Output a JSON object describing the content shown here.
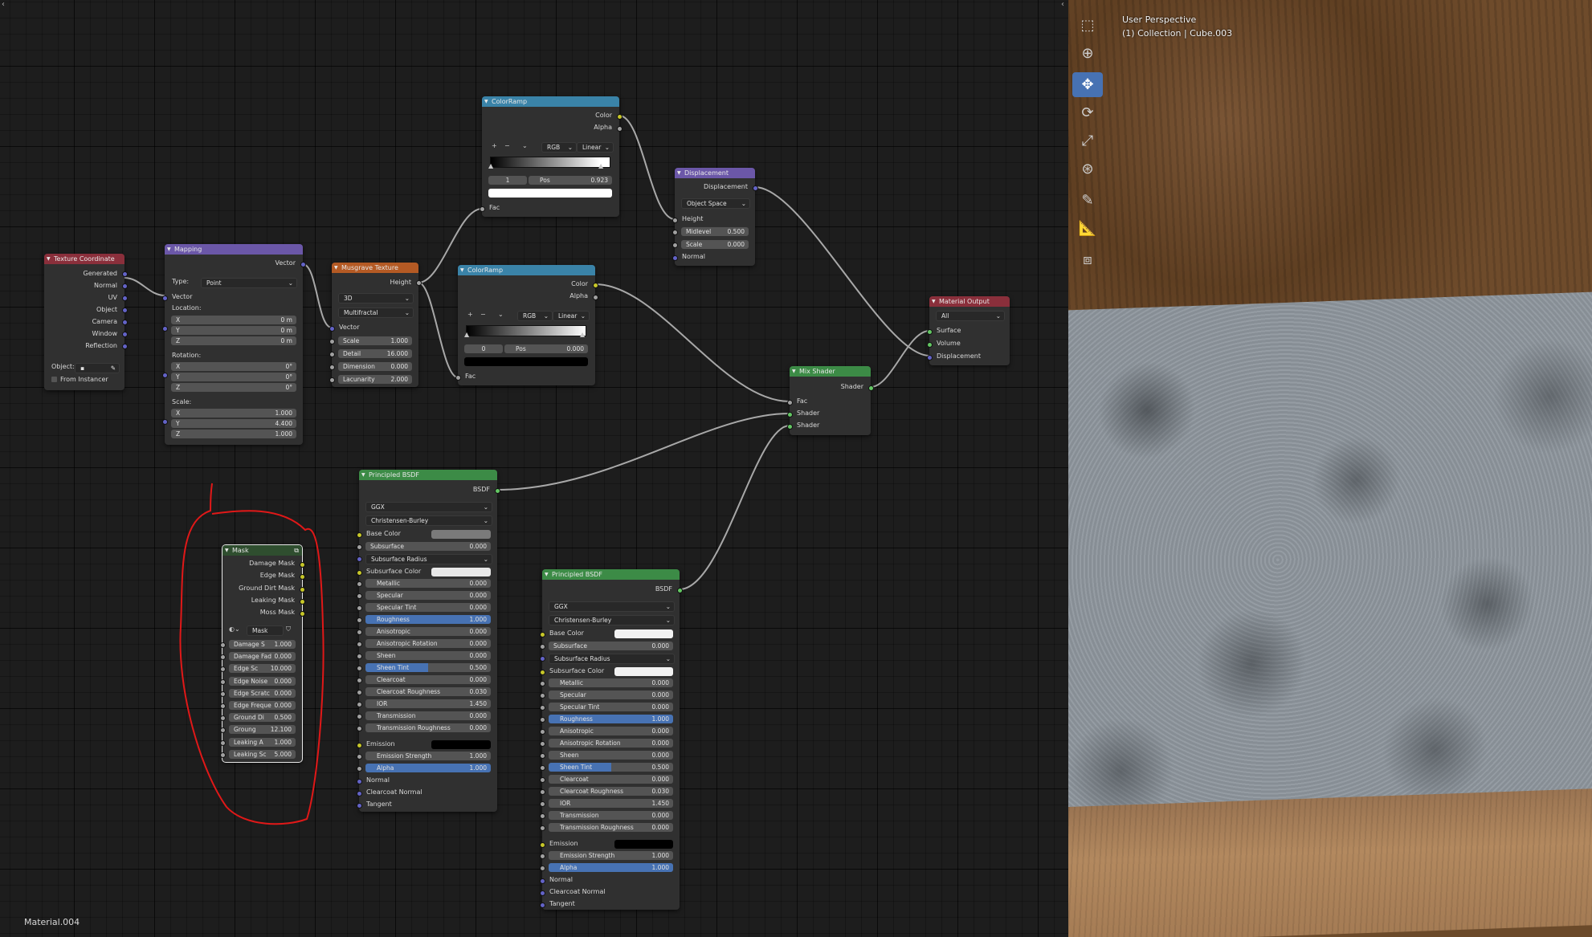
{
  "editor": {
    "material_name": "Material.004"
  },
  "viewport": {
    "title": "User Perspective",
    "subtitle": "(1) Collection | Cube.003",
    "tools": [
      "select-box-icon",
      "cursor-icon",
      "move-icon",
      "rotate-icon",
      "scale-icon",
      "transform-icon",
      "annotate-icon",
      "measure-icon",
      "add-cube-icon"
    ]
  },
  "nodes": {
    "texcoord": {
      "title": "Texture Coordinate",
      "outputs": [
        "Generated",
        "Normal",
        "UV",
        "Object",
        "Camera",
        "Window",
        "Reflection"
      ],
      "object_label": "Object:",
      "from_instancer": "From Instancer"
    },
    "mapping": {
      "title": "Mapping",
      "output": "Vector",
      "type_label": "Type:",
      "type_value": "Point",
      "vector_label": "Vector",
      "location_label": "Location:",
      "location": [
        {
          "l": "X",
          "v": "0 m"
        },
        {
          "l": "Y",
          "v": "0 m"
        },
        {
          "l": "Z",
          "v": "0 m"
        }
      ],
      "rotation_label": "Rotation:",
      "rotation": [
        {
          "l": "X",
          "v": "0°"
        },
        {
          "l": "Y",
          "v": "0°"
        },
        {
          "l": "Z",
          "v": "0°"
        }
      ],
      "scale_label": "Scale:",
      "scale": [
        {
          "l": "X",
          "v": "1.000"
        },
        {
          "l": "Y",
          "v": "4.400"
        },
        {
          "l": "Z",
          "v": "1.000"
        }
      ]
    },
    "musgrave": {
      "title": "Musgrave Texture",
      "output": "Height",
      "dim": "3D",
      "kind": "Multifractal",
      "vector": "Vector",
      "fields": [
        {
          "l": "Scale",
          "v": "1.000"
        },
        {
          "l": "Detail",
          "v": "16.000"
        },
        {
          "l": "Dimension",
          "v": "0.000"
        },
        {
          "l": "Lacunarity",
          "v": "2.000"
        }
      ]
    },
    "ramp1": {
      "title": "ColorRamp",
      "out_color": "Color",
      "out_alpha": "Alpha",
      "mode": "RGB",
      "interp": "Linear",
      "index": "1",
      "pos_label": "Pos",
      "pos_value": "0.923",
      "fac": "Fac",
      "swatch": "#ffffff"
    },
    "ramp2": {
      "title": "ColorRamp",
      "out_color": "Color",
      "out_alpha": "Alpha",
      "mode": "RGB",
      "interp": "Linear",
      "index": "0",
      "pos_label": "Pos",
      "pos_value": "0.000",
      "fac": "Fac",
      "swatch": "#000000"
    },
    "displacement": {
      "title": "Displacement",
      "output": "Displacement",
      "space": "Object Space",
      "height": "Height",
      "fields": [
        {
          "l": "Midlevel",
          "v": "0.500"
        },
        {
          "l": "Scale",
          "v": "0.000"
        }
      ],
      "normal": "Normal"
    },
    "matout": {
      "title": "Material Output",
      "target": "All",
      "inputs": [
        "Surface",
        "Volume",
        "Displacement"
      ]
    },
    "mix": {
      "title": "Mix Shader",
      "output": "Shader",
      "inputs": [
        "Fac",
        "Shader",
        "Shader"
      ]
    },
    "bsdf1": {
      "title": "Principled BSDF",
      "output": "BSDF",
      "dist": "GGX",
      "sss": "Christensen-Burley",
      "base_color_label": "Base Color",
      "base_color": "#7a7a7a",
      "subsurface_radius": "Subsurface Radius",
      "subsurface_color_label": "Subsurface Color",
      "subsurface_color": "#e8e8e8",
      "emission_label": "Emission",
      "emission_color": "#000000",
      "normal": "Normal",
      "clearcoat_normal": "Clearcoat Normal",
      "tangent": "Tangent",
      "subsurface": {
        "l": "Subsurface",
        "v": "0.000"
      },
      "fields": [
        {
          "l": "Metallic",
          "v": "0.000"
        },
        {
          "l": "Specular",
          "v": "0.000"
        },
        {
          "l": "Specular Tint",
          "v": "0.000"
        },
        {
          "l": "Roughness",
          "v": "1.000"
        },
        {
          "l": "Anisotropic",
          "v": "0.000"
        },
        {
          "l": "Anisotropic Rotation",
          "v": "0.000"
        },
        {
          "l": "Sheen",
          "v": "0.000"
        },
        {
          "l": "Sheen Tint",
          "v": "0.500"
        },
        {
          "l": "Clearcoat",
          "v": "0.000"
        },
        {
          "l": "Clearcoat Roughness",
          "v": "0.030"
        },
        {
          "l": "IOR",
          "v": "1.450"
        },
        {
          "l": "Transmission",
          "v": "0.000"
        },
        {
          "l": "Transmission Roughness",
          "v": "0.000"
        }
      ],
      "emission_strength": {
        "l": "Emission Strength",
        "v": "1.000"
      },
      "alpha": {
        "l": "Alpha",
        "v": "1.000"
      }
    },
    "bsdf2": {
      "title": "Principled BSDF",
      "output": "BSDF",
      "dist": "GGX",
      "sss": "Christensen-Burley",
      "base_color_label": "Base Color",
      "base_color": "#f2f2f2",
      "subsurface_radius": "Subsurface Radius",
      "subsurface_color_label": "Subsurface Color",
      "subsurface_color": "#f2f2f2",
      "emission_label": "Emission",
      "emission_color": "#000000",
      "normal": "Normal",
      "clearcoat_normal": "Clearcoat Normal",
      "tangent": "Tangent",
      "subsurface": {
        "l": "Subsurface",
        "v": "0.000"
      },
      "fields": [
        {
          "l": "Metallic",
          "v": "0.000"
        },
        {
          "l": "Specular",
          "v": "0.000"
        },
        {
          "l": "Specular Tint",
          "v": "0.000"
        },
        {
          "l": "Roughness",
          "v": "1.000"
        },
        {
          "l": "Anisotropic",
          "v": "0.000"
        },
        {
          "l": "Anisotropic Rotation",
          "v": "0.000"
        },
        {
          "l": "Sheen",
          "v": "0.000"
        },
        {
          "l": "Sheen Tint",
          "v": "0.500"
        },
        {
          "l": "Clearcoat",
          "v": "0.000"
        },
        {
          "l": "Clearcoat Roughness",
          "v": "0.030"
        },
        {
          "l": "IOR",
          "v": "1.450"
        },
        {
          "l": "Transmission",
          "v": "0.000"
        },
        {
          "l": "Transmission Roughness",
          "v": "0.000"
        }
      ],
      "emission_strength": {
        "l": "Emission Strength",
        "v": "1.000"
      },
      "alpha": {
        "l": "Alpha",
        "v": "1.000"
      }
    },
    "mask": {
      "title": "Mask",
      "outputs": [
        "Damage Mask",
        "Edge Mask",
        "Ground Dirt Mask",
        "Leaking Mask",
        "Moss Mask"
      ],
      "group_name": "Mask",
      "fields": [
        {
          "l": "Damage S",
          "v": "1.000"
        },
        {
          "l": "Damage Fad",
          "v": "0.000"
        },
        {
          "l": "Edge Sc",
          "v": "10.000"
        },
        {
          "l": "Edge Noise",
          "v": "0.000"
        },
        {
          "l": "Edge Scratc",
          "v": "0.000"
        },
        {
          "l": "Edge Freque",
          "v": "0.000"
        },
        {
          "l": "Ground Di",
          "v": "0.500"
        },
        {
          "l": "Groung",
          "v": "12.100"
        },
        {
          "l": "Leaking A",
          "v": "1.000"
        },
        {
          "l": "Leaking Sc",
          "v": "5.000"
        }
      ]
    }
  },
  "colors": {
    "annotation": "#e01818",
    "wire": "#a8a8a8",
    "active_tool": "#4772b3"
  }
}
